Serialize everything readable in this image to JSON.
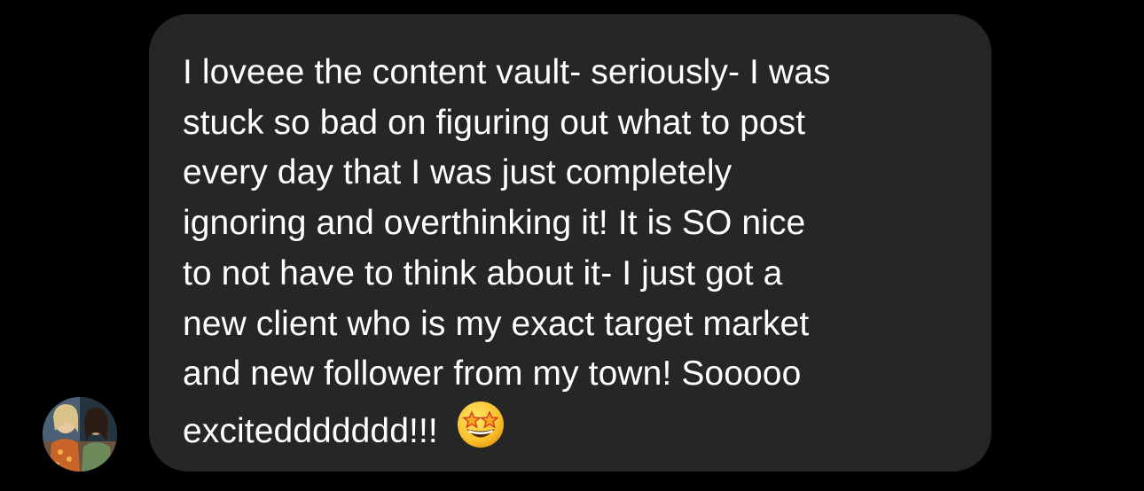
{
  "thread": {
    "sender": {
      "avatar_icon": "profile-photo-avatar"
    },
    "message": {
      "text": "I loveee the content vault- seriously- I was\nstuck so bad on figuring out what to post\nevery day that I was just completely\nignoring and overthinking it! It is SO nice\nto not have to think about it- I just got a\nnew client who is my exact target market\nand new follower from my town! Sooooo\nexciteddddddd!!!",
      "emoji_icon": "star-struck-emoji-icon"
    }
  },
  "colors": {
    "background": "#000000",
    "bubble": "#262626",
    "text": "#ffffff"
  }
}
